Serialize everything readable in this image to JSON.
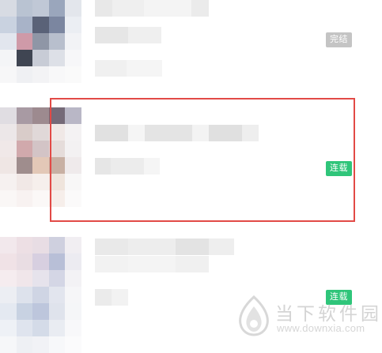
{
  "list": {
    "items": [
      {
        "status": "完结",
        "status_kind": "completed"
      },
      {
        "status": "连载",
        "status_kind": "serializing",
        "highlighted": true
      },
      {
        "status": "连载",
        "status_kind": "serializing"
      }
    ]
  },
  "colors": {
    "completed_badge": "#c4c4c4",
    "serializing_badge": "#2fc57a",
    "highlight_border": "#e24a46"
  },
  "watermark": {
    "site_name": "当下软件园",
    "url": "www.downxia.com"
  }
}
